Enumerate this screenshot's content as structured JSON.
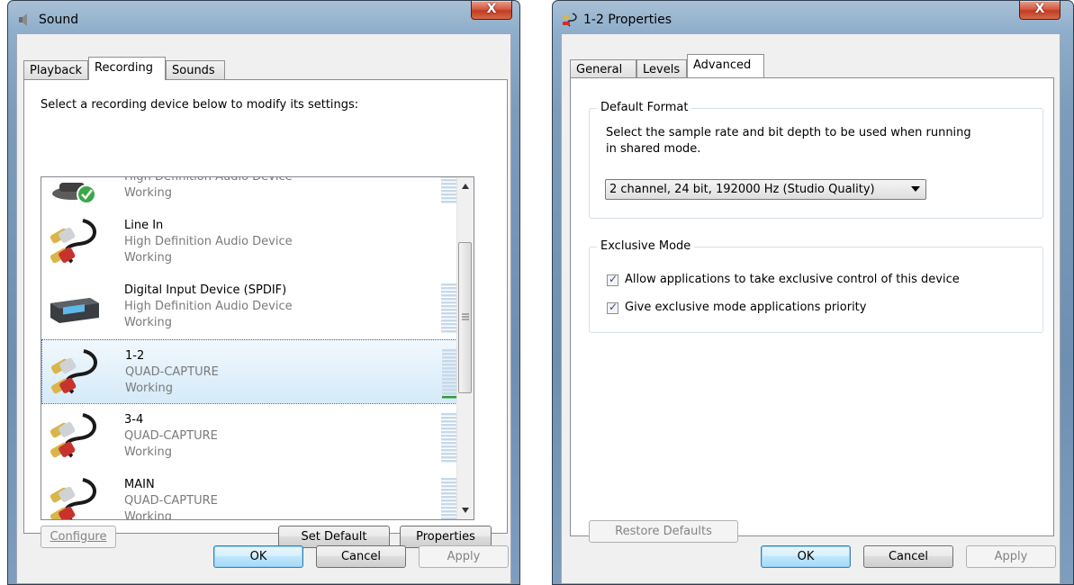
{
  "sound_dialog": {
    "title": "Sound",
    "close_glyph": "X",
    "tabs": [
      "Playback",
      "Recording",
      "Sounds"
    ],
    "active_tab": "Recording",
    "instruction": "Select a recording device below to modify its settings:",
    "devices": [
      {
        "name": "",
        "subtitle": "High Definition Audio Device",
        "status": "Working",
        "icon": "microphone-default-icon"
      },
      {
        "name": "Line In",
        "subtitle": "High Definition Audio Device",
        "status": "Working",
        "icon": "rca-cable-icon"
      },
      {
        "name": "Digital Input Device (SPDIF)",
        "subtitle": "High Definition Audio Device",
        "status": "Working",
        "icon": "digital-receiver-icon"
      },
      {
        "name": "1-2",
        "subtitle": "QUAD-CAPTURE",
        "status": "Working",
        "icon": "rca-cable-icon",
        "selected": true
      },
      {
        "name": "3-4",
        "subtitle": "QUAD-CAPTURE",
        "status": "Working",
        "icon": "rca-cable-icon"
      },
      {
        "name": "MAIN",
        "subtitle": "QUAD-CAPTURE",
        "status": "Working",
        "icon": "rca-cable-icon"
      }
    ],
    "buttons": {
      "configure": "Configure",
      "set_default": "Set Default",
      "properties": "Properties",
      "ok": "OK",
      "cancel": "Cancel",
      "apply": "Apply"
    }
  },
  "properties_dialog": {
    "title": "1-2 Properties",
    "close_glyph": "X",
    "tabs": [
      "General",
      "Levels",
      "Advanced"
    ],
    "active_tab": "Advanced",
    "default_format": {
      "legend": "Default Format",
      "description_line1": "Select the sample rate and bit depth to be used when running",
      "description_line2": "in shared mode.",
      "selected": "2 channel, 24 bit, 192000 Hz (Studio Quality)"
    },
    "exclusive_mode": {
      "legend": "Exclusive Mode",
      "options": [
        {
          "label": "Allow applications to take exclusive control of this device",
          "checked": true
        },
        {
          "label": "Give exclusive mode applications priority",
          "checked": true
        }
      ]
    },
    "buttons": {
      "restore_defaults": "Restore Defaults",
      "ok": "OK",
      "cancel": "Cancel",
      "apply": "Apply"
    }
  },
  "colors": {
    "selection": "#d5eaf8",
    "meter_active": "#2e9b3c",
    "close_button": "#c23b22"
  }
}
